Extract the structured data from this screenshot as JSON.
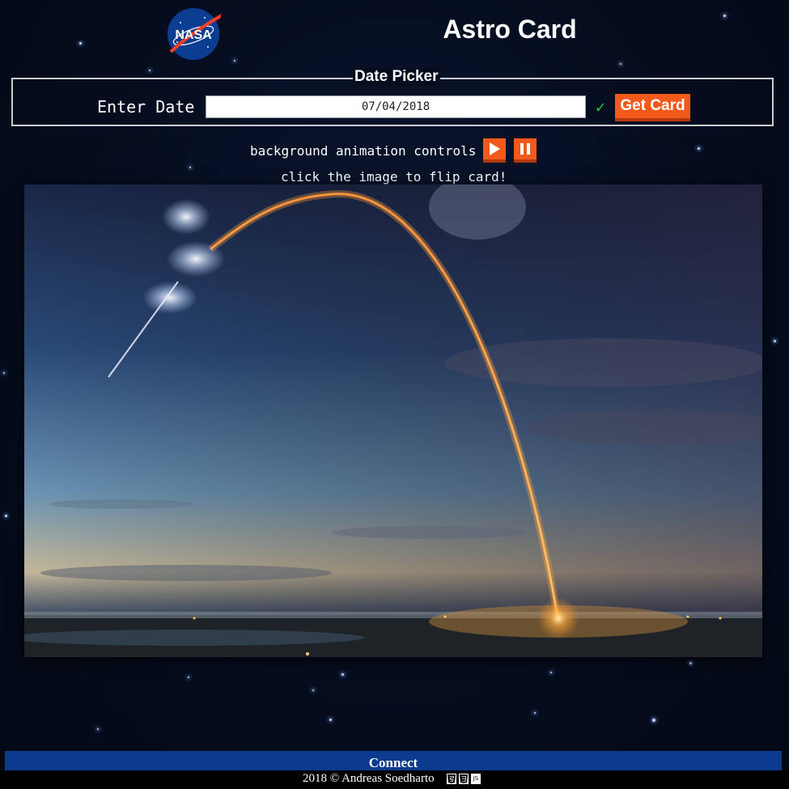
{
  "header": {
    "logo_text": "NASA",
    "title": "Astro Card"
  },
  "date_picker": {
    "legend": "Date Picker",
    "label": "Enter Date",
    "value": "07/04/2018",
    "check": "✓",
    "button_label": "Get Card"
  },
  "animation": {
    "label": "background animation controls",
    "play_icon": "play-icon",
    "pause_icon": "pause-icon",
    "flip_hint": "click the image to flip card!"
  },
  "card": {
    "image_subject": "rocket-launch-arc"
  },
  "footer": {
    "connect": "Connect",
    "credit": "2018 © Andreas Soedharto",
    "tech_icons": [
      "html5-icon",
      "css3-icon",
      "js-icon"
    ],
    "tech_icon_text": {
      "js": "JS"
    }
  },
  "colors": {
    "accent": "#f25a1c",
    "footer_bar": "#0b3a8f",
    "check": "#1fd13b",
    "background": "#050b1a"
  }
}
